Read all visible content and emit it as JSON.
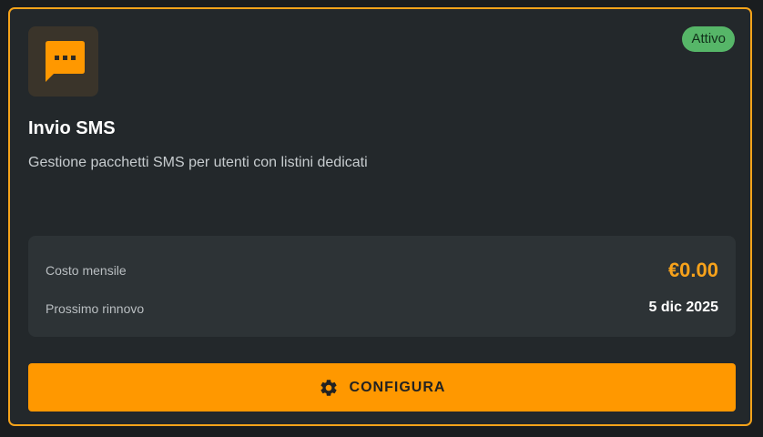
{
  "card": {
    "icon": "chat-bubble-dots-icon",
    "status": "Attivo",
    "title": "Invio SMS",
    "description": "Gestione pacchetti SMS per utenti con listini dedicati",
    "info": {
      "cost_label": "Costo mensile",
      "cost_value": "€0.00",
      "renewal_label": "Prossimo rinnovo",
      "renewal_value": "5 dic 2025"
    },
    "button": {
      "icon": "gear-icon",
      "label": "CONFIGURA"
    }
  },
  "colors": {
    "accent": "#ff9800",
    "status_active": "#56b668",
    "card_background": "#23282b"
  }
}
